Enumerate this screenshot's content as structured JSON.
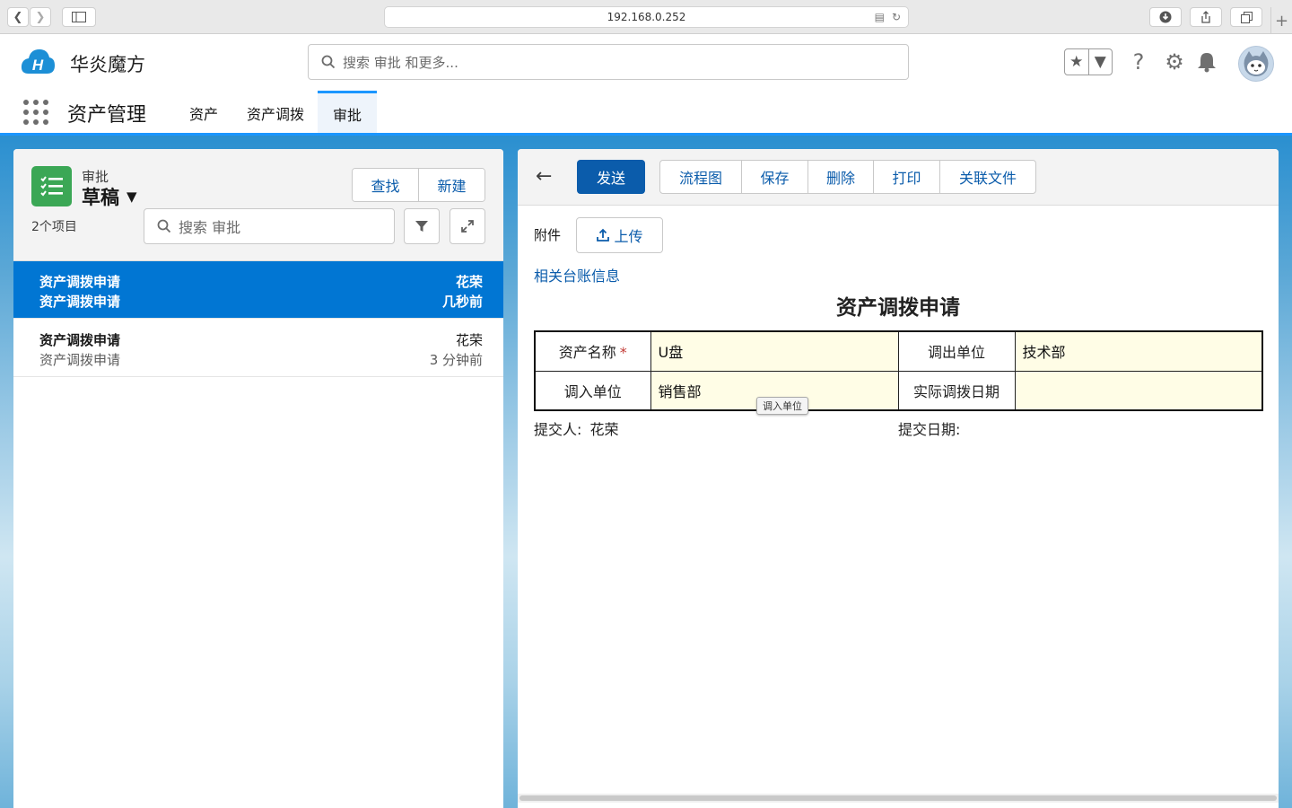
{
  "browser": {
    "url": "192.168.0.252"
  },
  "header": {
    "brand": "华炎魔方",
    "search_placeholder": "搜索 审批 和更多..."
  },
  "nav": {
    "app_name": "资产管理",
    "tabs": [
      {
        "label": "资产"
      },
      {
        "label": "资产调拨"
      },
      {
        "label": "审批"
      }
    ],
    "active_tab": "审批"
  },
  "list_panel": {
    "object_label": "审批",
    "list_view": "草稿",
    "find_button": "查找",
    "new_button": "新建",
    "item_count": "2个项目",
    "search_placeholder": "搜索 审批",
    "items": [
      {
        "title": "资产调拨申请",
        "subtitle": "资产调拨申请",
        "owner": "花荣",
        "time": "几秒前",
        "selected": true
      },
      {
        "title": "资产调拨申请",
        "subtitle": "资产调拨申请",
        "owner": "花荣",
        "time": "3 分钟前",
        "selected": false
      }
    ]
  },
  "detail_panel": {
    "toolbar": {
      "send": "发送",
      "flowchart": "流程图",
      "save": "保存",
      "delete": "删除",
      "print": "打印",
      "related_files": "关联文件"
    },
    "attachment_label": "附件",
    "upload_button": "上传",
    "related_link": "相关台账信息",
    "form_title": "资产调拨申请",
    "fields": {
      "asset_name_label": "资产名称",
      "asset_name_value": "U盘",
      "out_unit_label": "调出单位",
      "out_unit_value": "技术部",
      "in_unit_label": "调入单位",
      "in_unit_value": "销售部",
      "actual_date_label": "实际调拨日期",
      "actual_date_value": ""
    },
    "required_mark": "*",
    "tooltip": "调入单位",
    "submitter_label": "提交人:",
    "submitter_value": "花荣",
    "submit_date_label": "提交日期:"
  },
  "colors": {
    "brand_blue": "#0176d3",
    "button_blue": "#0b5cab",
    "object_icon_green": "#3ba755",
    "form_field_bg": "#fffde6"
  }
}
